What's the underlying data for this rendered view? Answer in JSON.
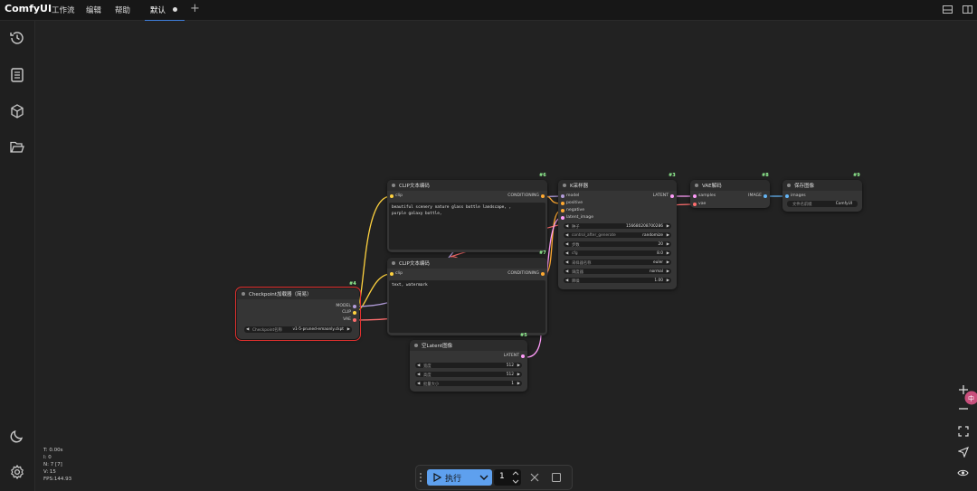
{
  "app": {
    "name": "ComfyUI"
  },
  "menu": [
    "工作流",
    "编辑",
    "帮助"
  ],
  "tab": {
    "label": "默认"
  },
  "nodes": {
    "clip_text_1": {
      "id": "#6",
      "title": "CLIP文本编码",
      "input": "clip",
      "output": "CONDITIONING",
      "text_line1": "beautiful scenery nature glass bottle landscape, ,",
      "text_line2": "purple galaxy bottle,"
    },
    "clip_text_2": {
      "id": "#7",
      "title": "CLIP文本编码",
      "input": "clip",
      "output": "CONDITIONING",
      "text_line1": "text, watermark"
    },
    "checkpoint": {
      "id": "#4",
      "title": "Checkpoint加载器（简易）",
      "outputs": [
        "MODEL",
        "CLIP",
        "VAE"
      ],
      "widget_label": "Checkpoint名称",
      "widget_value": "v1-5-pruned-emaonly.ckpt"
    },
    "ksampler": {
      "id": "#3",
      "title": "K采样器",
      "inputs": [
        "model",
        "positive",
        "negative",
        "latent_image"
      ],
      "output": "LATENT",
      "widgets": [
        {
          "label": "种子",
          "value": "156680208700286"
        },
        {
          "label": "control_after_generate",
          "value": "randomize"
        },
        {
          "label": "步数",
          "value": "20"
        },
        {
          "label": "cfg",
          "value": "8.0"
        },
        {
          "label": "采样器名称",
          "value": "euler"
        },
        {
          "label": "调度器",
          "value": "normal"
        },
        {
          "label": "降噪",
          "value": "1.00"
        }
      ]
    },
    "vae_decode": {
      "id": "#8",
      "title": "VAE解码",
      "inputs": [
        "samples",
        "vae"
      ],
      "output": "IMAGE"
    },
    "save_image": {
      "id": "#9",
      "title": "保存图像",
      "input": "images",
      "widget_label": "文件名前缀",
      "widget_value": "ComfyUI"
    },
    "empty_latent": {
      "id": "#5",
      "title": "空Latent图像",
      "output": "LATENT",
      "widgets": [
        {
          "label": "宽度",
          "value": "512"
        },
        {
          "label": "高度",
          "value": "512"
        },
        {
          "label": "批量大小",
          "value": "1"
        }
      ]
    }
  },
  "stats": {
    "t": "T: 0.00s",
    "i": "I: 0",
    "n": "N: 7 [7]",
    "v": "V: 15",
    "fps": "FPS:144.93"
  },
  "run": {
    "label": "执行",
    "count": "1"
  }
}
